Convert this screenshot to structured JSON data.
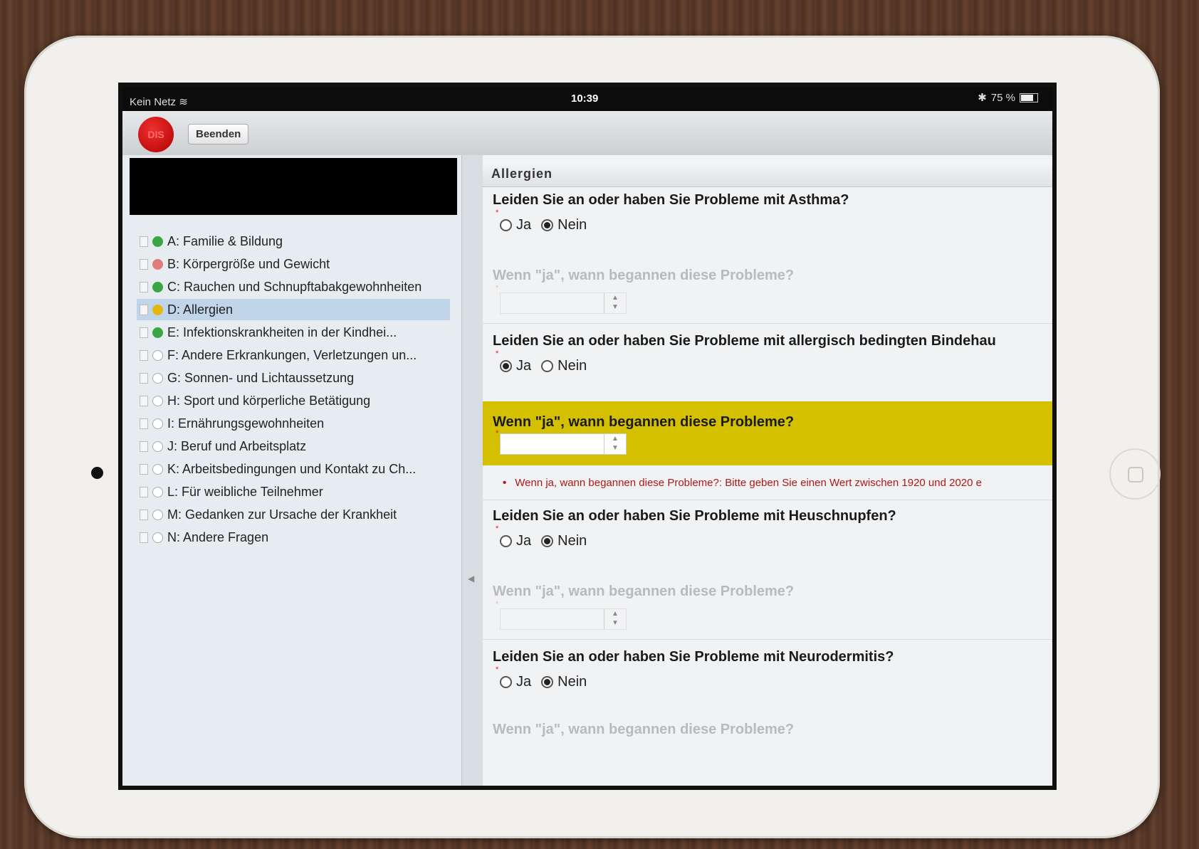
{
  "status": {
    "carrier": "Kein Netz",
    "time": "10:39",
    "battery": "75 %"
  },
  "toolbar": {
    "logo": "DIS",
    "end_label": "Beenden"
  },
  "nav": [
    {
      "label": "A: Familie & Bildung",
      "state": "green"
    },
    {
      "label": "B: Körpergröße und Gewicht",
      "state": "red"
    },
    {
      "label": "C: Rauchen und Schnupftabakgewohnheiten",
      "state": "green"
    },
    {
      "label": "D: Allergien",
      "state": "yellow",
      "active": true
    },
    {
      "label": "E: Infektionskrankheiten in der Kindhei...",
      "state": "green"
    },
    {
      "label": "F: Andere Erkrankungen, Verletzungen un...",
      "state": "empty"
    },
    {
      "label": "G: Sonnen- und Lichtaussetzung",
      "state": "empty"
    },
    {
      "label": "H: Sport und körperliche Betätigung",
      "state": "empty"
    },
    {
      "label": "I: Ernährungsgewohnheiten",
      "state": "empty"
    },
    {
      "label": "J: Beruf und Arbeitsplatz",
      "state": "empty"
    },
    {
      "label": "K: Arbeitsbedingungen und Kontakt zu Ch...",
      "state": "empty"
    },
    {
      "label": "L: Für weibliche Teilnehmer",
      "state": "empty"
    },
    {
      "label": "M: Gedanken zur Ursache der Krankheit",
      "state": "empty"
    },
    {
      "label": "N: Andere Fragen",
      "state": "empty"
    }
  ],
  "status_colors": {
    "green": "#3aa544",
    "red": "#e07c7c",
    "yellow": "#e2b80e",
    "empty": "#ffffff"
  },
  "section": {
    "title": "Allergien"
  },
  "radio_labels": {
    "yes": "Ja",
    "no": "Nein"
  },
  "questions": {
    "q1": "Leiden Sie an oder haben Sie Probleme mit Asthma?",
    "q1_answer": "Nein",
    "q1_followup": "Wenn \"ja\", wann begannen diese Probleme?",
    "q2": "Leiden Sie an oder haben Sie Probleme mit allergisch bedingten Bindehau",
    "q2_answer": "Ja",
    "q2_followup": "Wenn \"ja\", wann begannen diese Probleme?",
    "q3": "Leiden Sie an oder haben Sie Probleme mit Heuschnupfen?",
    "q3_answer": "Nein",
    "q3_followup": "Wenn \"ja\", wann begannen diese Probleme?",
    "q4": "Leiden Sie an oder haben Sie Probleme mit Neurodermitis?",
    "q4_answer": "Nein",
    "q4_followup": "Wenn \"ja\", wann begannen diese Probleme?"
  },
  "error_message": "Wenn ja, wann begannen diese Probleme?: Bitte geben Sie einen Wert zwischen 1920 und 2020 e",
  "error_bullet": "•",
  "required_mark": "*"
}
